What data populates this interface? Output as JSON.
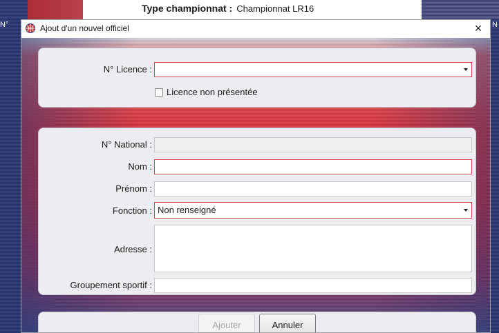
{
  "background": {
    "header_label": "Type championnat :",
    "header_value": "Championnat LR16",
    "left_edge_text": "N°",
    "right_edge_text": "N"
  },
  "dialog": {
    "title": "Ajout d'un nouvel officiel",
    "close_glyph": "×",
    "icon": "basketball-logo-icon"
  },
  "licence_section": {
    "licence_label": "N° Licence :",
    "licence_value": "",
    "licence_not_presented_label": "Licence non présentée",
    "licence_not_presented_checked": false
  },
  "details_section": {
    "national_label": "N° National :",
    "national_value": "",
    "nom_label": "Nom :",
    "nom_value": "",
    "prenom_label": "Prénom :",
    "prenom_value": "",
    "fonction_label": "Fonction :",
    "fonction_value": "Non renseigné",
    "adresse_label": "Adresse :",
    "adresse_value": "",
    "groupement_label": "Groupement sportif :",
    "groupement_value": ""
  },
  "actions": {
    "add_label": "Ajouter",
    "add_enabled": false,
    "cancel_label": "Annuler"
  },
  "colors": {
    "invalid_border": "#d64550",
    "panel_background": "#ececf1",
    "brand_red": "#cb2a39",
    "brand_blue": "#3d4a82"
  }
}
